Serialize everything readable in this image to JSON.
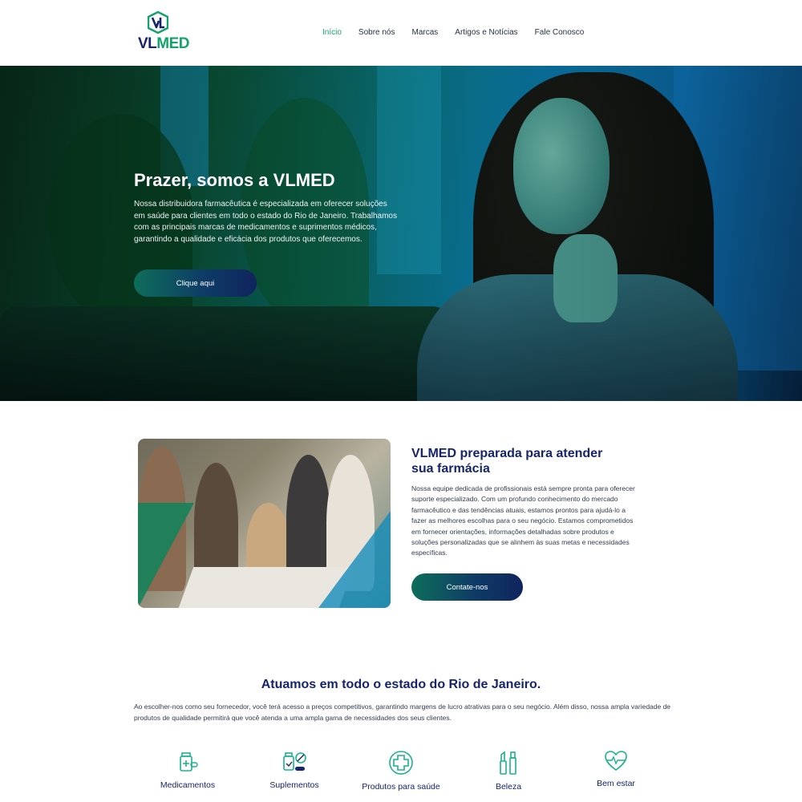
{
  "header": {
    "logo_text_a": "VL",
    "logo_text_b": "MED",
    "nav": [
      {
        "label": "Início",
        "active": true
      },
      {
        "label": "Sobre nós",
        "active": false
      },
      {
        "label": "Marcas",
        "active": false
      },
      {
        "label": "Artigos e Notícias",
        "active": false
      },
      {
        "label": "Fale Conosco",
        "active": false
      }
    ]
  },
  "hero": {
    "title": "Prazer, somos a VLMED",
    "text": "Nossa distribuidora farmacêutica é especializada em oferecer soluções em saúde para clientes em todo o estado do Rio de Janeiro. Trabalhamos com as principais marcas de medicamentos e suprimentos médicos, garantindo a qualidade e eficácia dos produtos que oferecemos.",
    "button": "Clique aqui"
  },
  "about": {
    "title": "VLMED preparada para atender sua farmácia",
    "text": "Nossa equipe dedicada de profissionais está sempre pronta para oferecer suporte especializado. Com um profundo conhecimento do mercado farmacêutico e das tendências atuais, estamos prontos para ajudá-lo a fazer as melhores escolhas para o seu negócio. Estamos comprometidos em fornecer orientações, informações detalhadas sobre produtos e soluções personalizadas que se alinhem às suas metas e necessidades específicas.",
    "button": "Contate-nos"
  },
  "coverage": {
    "title": "Atuamos em todo o estado do Rio de Janeiro.",
    "text": "Ao escolher-nos como seu fornecedor, você terá acesso a preços competitivos, garantindo margens de lucro atrativas para o seu negócio. Além disso, nossa ampla variedade de produtos de qualidade permitirá que você atenda a uma ampla gama de necessidades dos seus clientes.",
    "categories": [
      {
        "label": "Medicamentos",
        "icon": "medicine-bottle-icon"
      },
      {
        "label": "Suplementos",
        "icon": "supplements-icon"
      },
      {
        "label": "Produtos para saúde",
        "icon": "health-cross-icon"
      },
      {
        "label": "Beleza",
        "icon": "cosmetics-icon"
      },
      {
        "label": "Bem estar",
        "icon": "heart-pulse-icon"
      }
    ]
  },
  "colors": {
    "brand_navy": "#16246b",
    "brand_green": "#13a36a",
    "icon_teal": "#1bb28a"
  }
}
